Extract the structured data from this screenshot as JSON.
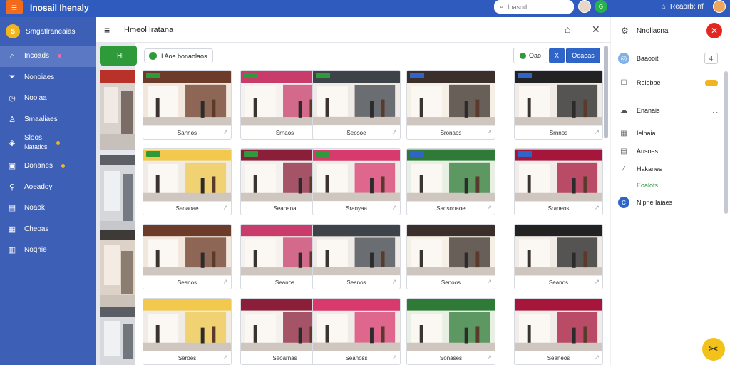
{
  "app": {
    "title": "Inosail Ihenaly",
    "search_placeholder": "Ioasod",
    "user_label": "Reaorb: nf",
    "avatar_initial": "G"
  },
  "sidebar": {
    "header": "Smgatlraneaias",
    "items": [
      {
        "label": "Incoads",
        "icon": "home-icon",
        "badge": "pink",
        "active": true
      },
      {
        "label": "Nonoiaes",
        "icon": "filter-icon"
      },
      {
        "label": "Nooiaa",
        "icon": "clock-icon"
      },
      {
        "label": "Smaaliaes",
        "icon": "user-icon"
      },
      {
        "label": "Sloos",
        "sub": "Natatlcs",
        "icon": "tag-icon",
        "badge": "yellow"
      },
      {
        "label": "Donanes",
        "icon": "chart-icon",
        "badge": "yellow"
      },
      {
        "label": "Aoeadoy",
        "icon": "pin-icon"
      },
      {
        "label": "Noaok",
        "icon": "doc-icon"
      },
      {
        "label": "Cheoas",
        "icon": "calendar-icon"
      },
      {
        "label": "Noqhie",
        "icon": "print-icon"
      }
    ]
  },
  "main": {
    "title": "Hmeol Iratana",
    "chip_label": "I Aoe bonaolaos",
    "toolbar": {
      "btn1": "Oao",
      "btn2": "X",
      "btn3": "Ooaeas"
    },
    "strip_button": "Hi",
    "cards": [
      [
        "Sannos",
        "Srnaos",
        "Seosoe",
        "Sronaos",
        "Srnnos"
      ],
      [
        "Seoaoae",
        "Seaoaoa",
        "Sraoyaa",
        "Saosonaoe",
        "Sraneos"
      ],
      [
        "Seanos",
        "Seanos",
        "Seanos",
        "Senoos",
        "Seanos"
      ],
      [
        "Seroes",
        "Seoarnas",
        "Seanoss",
        "Sonases",
        "Seaneos"
      ]
    ]
  },
  "right_panel": {
    "title": "Nnoliacna",
    "rows": [
      {
        "label": "Baaooiti",
        "icon": "circle-icon",
        "trail": "4"
      },
      {
        "label": "Reiobbe",
        "icon": "chat-icon",
        "trail": "badge"
      },
      {
        "label": "Enanais",
        "icon": "cloud-icon",
        "trail": ". ."
      },
      {
        "label": "Ielnaia",
        "icon": "table-icon",
        "trail": ". ."
      },
      {
        "label": "Ausoes",
        "icon": "grid-icon",
        "trail": ". ."
      },
      {
        "label": "Hakanes",
        "icon": "edit-icon"
      },
      {
        "label": "Eoalots",
        "icon": "none",
        "green": true
      },
      {
        "label": "Nipne Iaiaes",
        "icon": "blue-dot-icon"
      }
    ]
  }
}
